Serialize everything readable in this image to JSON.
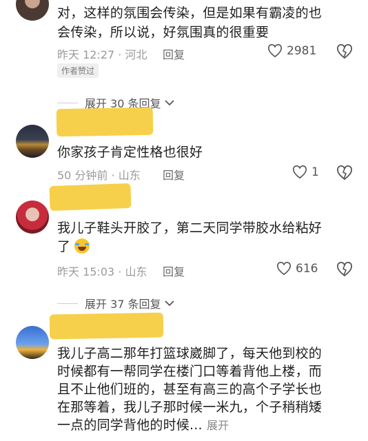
{
  "comments": [
    {
      "text_line1": "对，这样的氛围会传染，但是如果有霸凌的也",
      "text_line2": "会传染，所以说，好氛围真的很重要",
      "meta": "昨天 12:27 · 河北",
      "reply": "回复",
      "likes": "2981",
      "badge": "作者赞过"
    },
    {
      "text_line1": "你家孩子肯定性格也很好",
      "meta": "50 分钟前 · 山东",
      "reply": "回复",
      "likes": "1"
    },
    {
      "text_line1": "我儿子鞋头开胶了，第二天同学带胶水给粘好",
      "text_line2": "了",
      "meta": "昨天 15:03 · 山东",
      "reply": "回复",
      "likes": "616"
    },
    {
      "text_line1": "我儿子高二那年打篮球崴脚了，每天他到校的",
      "text_line2": "时候都有一帮同学在楼门口等着背他上楼，而",
      "text_line3": "且不止他们班的，甚至有高三的高个子学长也",
      "text_line4": "在那等着，我儿子那时候一米九，个子稍稍矮",
      "text_line5": "一点的同学背他的时候...",
      "more": "展开"
    }
  ],
  "expanders": [
    {
      "label": "展开 30 条回复"
    },
    {
      "label": "展开 37 条回复"
    }
  ],
  "colors": {
    "redaction": "#f6d04b",
    "meta": "#9a9a9a",
    "background": "#ffffff"
  }
}
